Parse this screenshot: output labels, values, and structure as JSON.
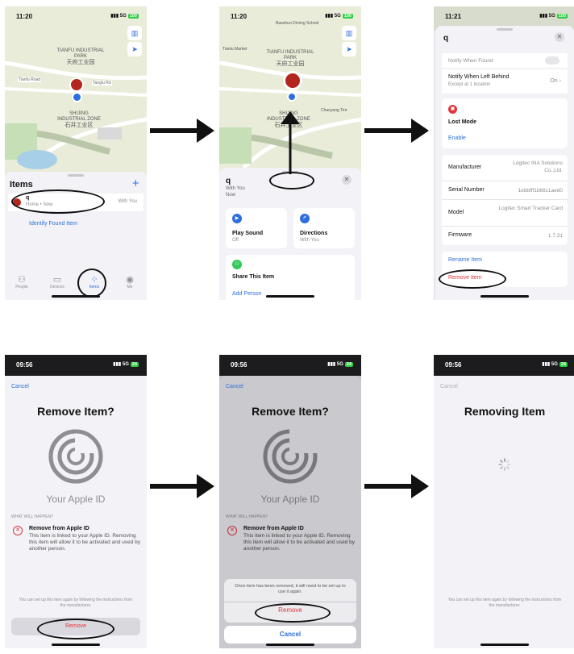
{
  "p1": {
    "time": "11:20",
    "signal": "5G",
    "battery": "100",
    "map": {
      "district_en": "TIANFU INDUSTRIAL PARK",
      "district_zh": "天府工业园",
      "district2_en": "SHIJING INDUSTRIAL ZONE",
      "district2_zh": "石井工业区",
      "road1": "Tianfu Road",
      "road2": "Tanglu Rd"
    },
    "header": "Items",
    "add_icon": "+",
    "item": {
      "name": "q",
      "subtitle": "Home • Now",
      "status": "With You"
    },
    "identify_link": "Identify Found Item",
    "tabs": [
      "People",
      "Devices",
      "Items",
      "Me"
    ]
  },
  "p2": {
    "time": "11:20",
    "signal": "5G",
    "battery": "100",
    "map": {
      "district_en": "TIANFU INDUSTRIAL PARK",
      "district_zh": "天府工业园",
      "district2_en": "SHIJING INDUSTRIAL ZONE",
      "district2_zh": "石井工业区",
      "poi1": "Baoshun Driving School",
      "poi2": "Tiantu Market",
      "poi3": "Chaoyang Tire"
    },
    "item": {
      "name": "q",
      "sub1": "With You",
      "sub2": "Now"
    },
    "play": {
      "title": "Play Sound",
      "sub": "Off"
    },
    "directions": {
      "title": "Directions",
      "sub": "With You"
    },
    "share": {
      "title": "Share This Item",
      "add": "Add Person"
    }
  },
  "p3": {
    "time": "11:21",
    "signal": "5G",
    "battery": "100",
    "title": "q",
    "notify_found": "Notify When Found",
    "notify_left": "Notify When Left Behind",
    "notify_left_sub": "Except at 1 location",
    "notify_left_val": "On",
    "lost_mode": "Lost Mode",
    "enable": "Enable",
    "rows": [
      {
        "label": "Manufacturer",
        "value": "Logitec INA Solutions Co.,Ltd."
      },
      {
        "label": "Serial Number",
        "value": "1ebbfff1b66c1aed0"
      },
      {
        "label": "Model",
        "value": "Logitec Smart Tracker Card"
      },
      {
        "label": "Firmware",
        "value": "1.7.31"
      }
    ],
    "rename": "Rename Item",
    "remove": "Remove Item"
  },
  "p4": {
    "time": "09:56",
    "signal": "5G",
    "battery": "24",
    "cancel": "Cancel",
    "title": "Remove Item?",
    "apple_id": "Your Apple ID",
    "section": "WHAT WILL HAPPEN?",
    "point_title": "Remove from Apple ID",
    "point_body": "This item is linked to your Apple ID. Removing this item will allow it to be activated and used by another person.",
    "footer": "You can set up this item again by following the instructions from the manufacturer.",
    "remove_btn": "Remove"
  },
  "p5": {
    "time": "09:56",
    "signal": "5G",
    "battery": "24",
    "cancel": "Cancel",
    "title": "Remove Item?",
    "apple_id": "Your Apple ID",
    "section": "WHAT WILL HAPPEN?",
    "point_title": "Remove from Apple ID",
    "point_body": "This item is linked to your Apple ID. Removing this item will allow it to be activated and used by another person.",
    "sheet_msg": "Once item has been removed, it will need to be set up to use it again.",
    "sheet_remove": "Remove",
    "sheet_cancel": "Cancel"
  },
  "p6": {
    "time": "09:56",
    "signal": "5G",
    "battery": "24",
    "cancel": "Cancel",
    "title": "Removing Item",
    "footer": "You can set up this item again by following the instructions from the manufacturer."
  },
  "colors": {
    "accent": "#2c6fdc",
    "danger": "#e0353b",
    "map": "#e8ecd9",
    "arrow": "#111111"
  }
}
